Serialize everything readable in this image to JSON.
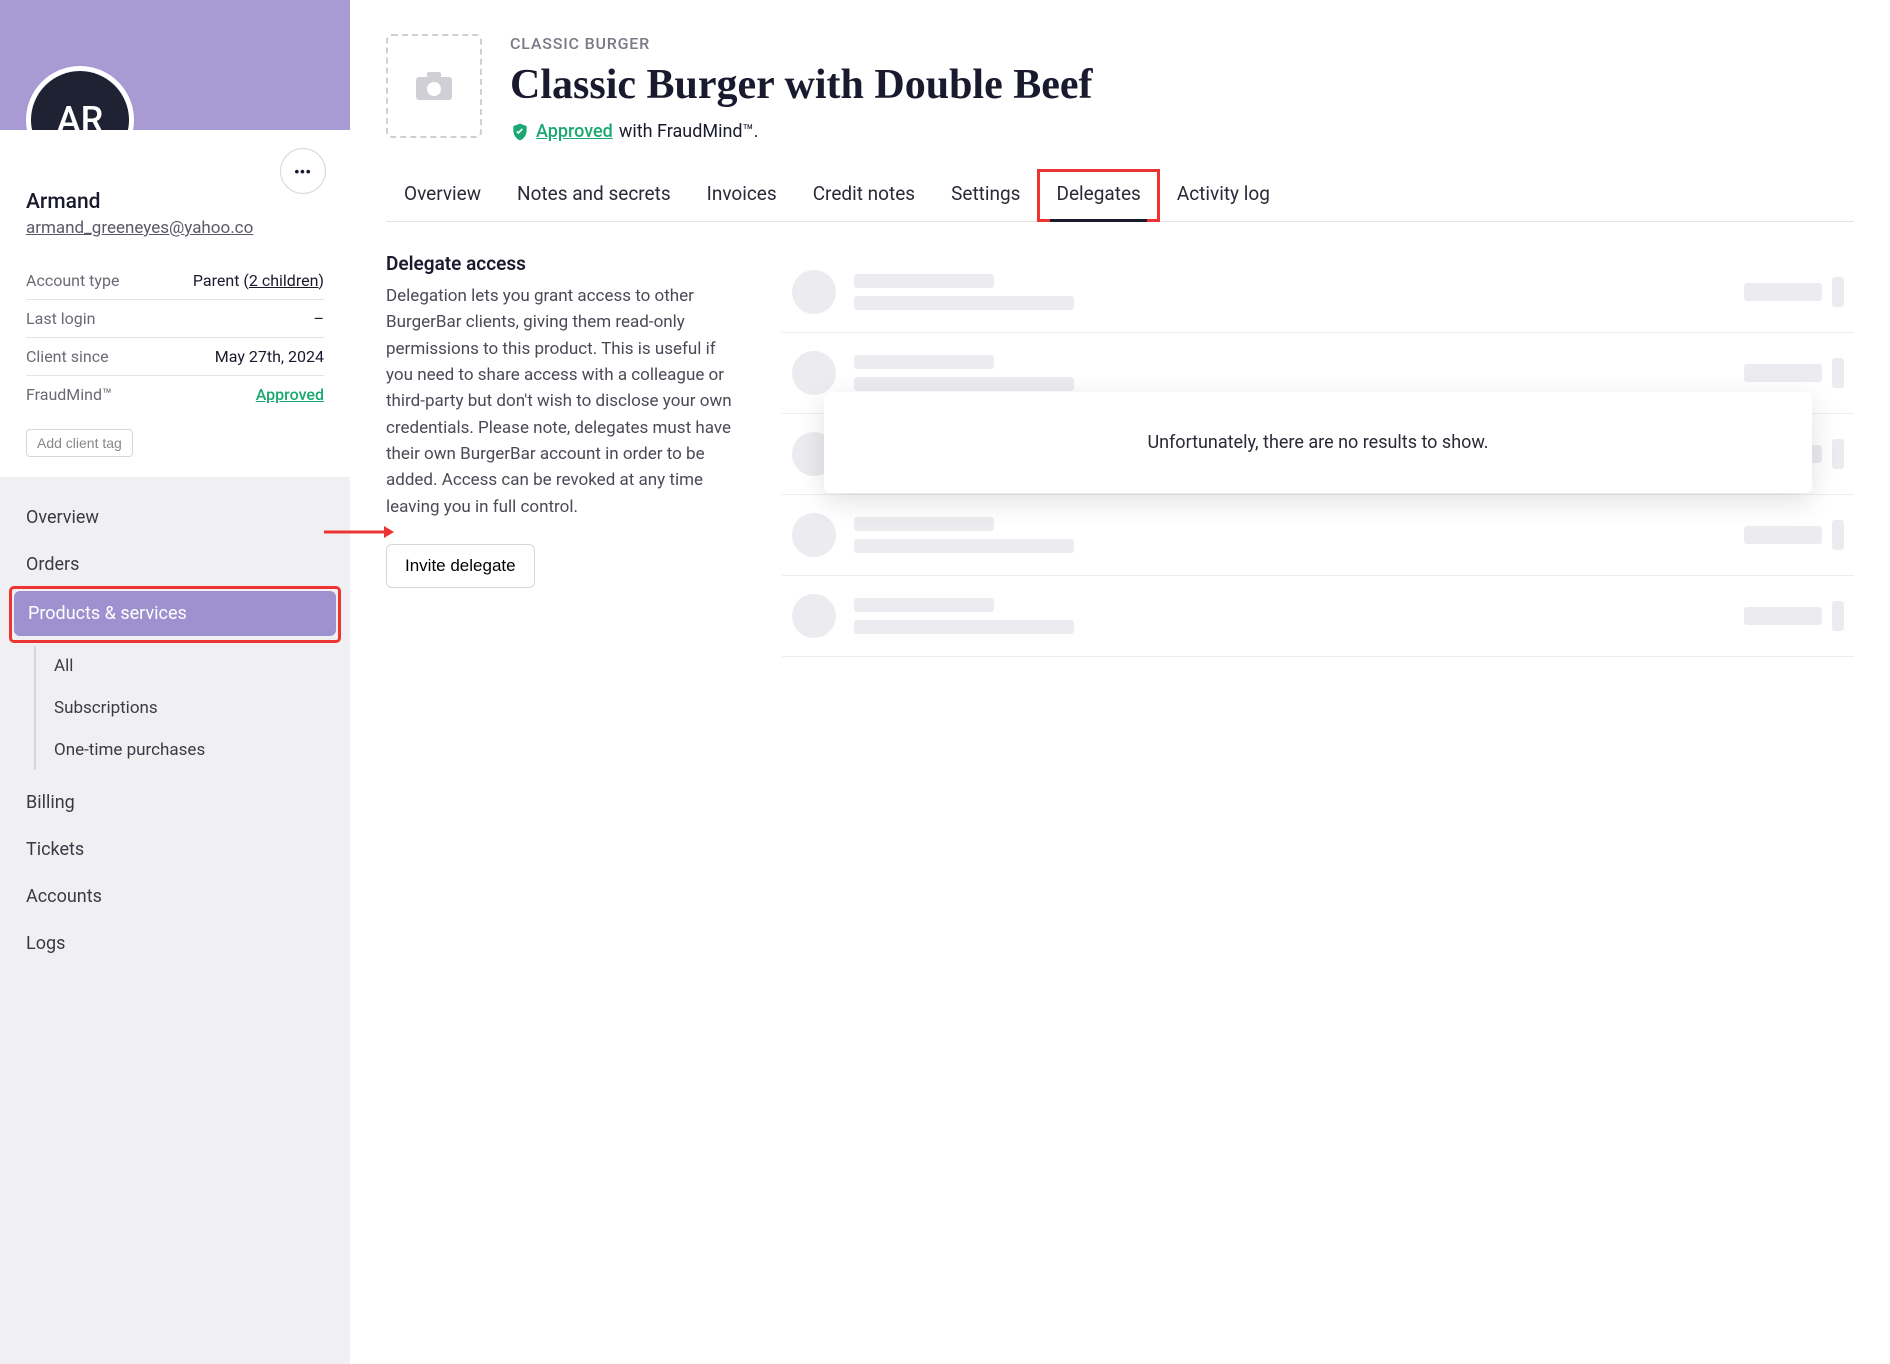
{
  "client": {
    "initials": "AR",
    "name": "Armand",
    "email": "armand_greeneyes@yahoo.co",
    "info": {
      "account_type_label": "Account type",
      "account_type_value_prefix": "Parent (",
      "account_type_children": "2 children",
      "account_type_value_suffix": ")",
      "last_login_label": "Last login",
      "last_login_value": "–",
      "client_since_label": "Client since",
      "client_since_value": "May 27th, 2024",
      "fraudmind_label": "FraudMind™",
      "fraudmind_value": "Approved"
    },
    "add_tag_label": "Add client tag"
  },
  "nav": {
    "overview": "Overview",
    "orders": "Orders",
    "products": "Products & services",
    "sub_all": "All",
    "sub_subscriptions": "Subscriptions",
    "sub_onetime": "One-time purchases",
    "billing": "Billing",
    "tickets": "Tickets",
    "accounts": "Accounts",
    "logs": "Logs"
  },
  "product": {
    "breadcrumb": "CLASSIC BURGER",
    "title": "Classic Burger with Double Beef",
    "status_approved": "Approved",
    "status_suffix": " with FraudMind™."
  },
  "tabs": {
    "overview": "Overview",
    "notes": "Notes and secrets",
    "invoices": "Invoices",
    "credit": "Credit notes",
    "settings": "Settings",
    "delegates": "Delegates",
    "activity": "Activity log"
  },
  "delegates": {
    "title": "Delegate access",
    "description": "Delegation lets you grant access to other BurgerBar clients, giving them read-only permissions to this product. This is useful if you need to share access with a colleague or third-party but don't wish to disclose your own credentials. Please note, delegates must have their own BurgerBar account in order to be added. Access can be revoked at any time leaving you in full control.",
    "invite_label": "Invite delegate",
    "empty_message": "Unfortunately, there are no results to show."
  }
}
